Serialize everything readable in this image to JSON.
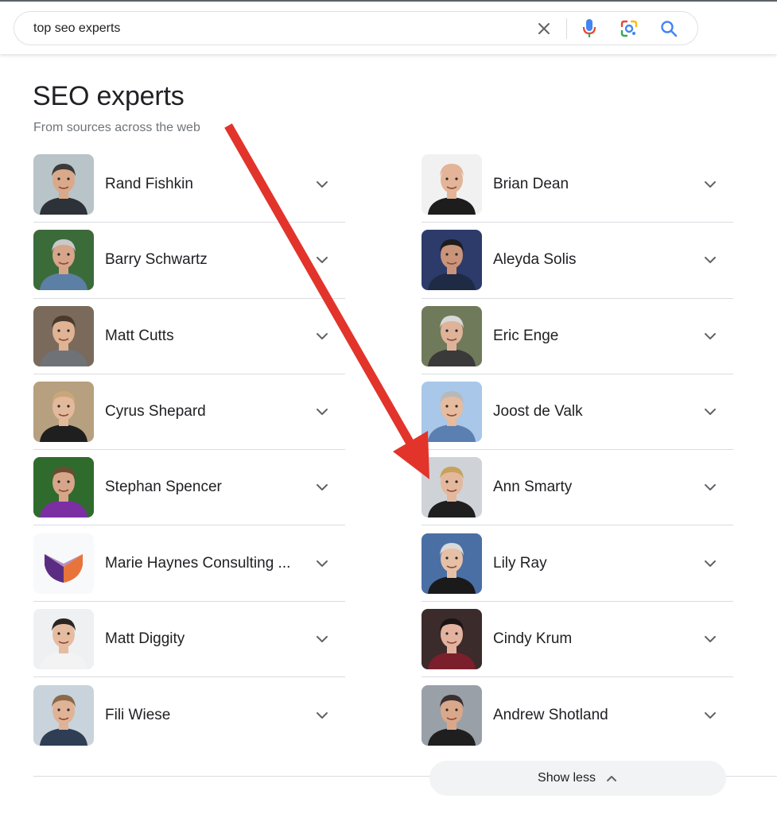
{
  "search": {
    "query": "top seo experts",
    "clear_icon": "close-icon",
    "voice_icon": "mic-icon",
    "lens_icon": "lens-icon",
    "search_icon": "search-icon"
  },
  "section": {
    "title": "SEO experts",
    "subtitle": "From sources across the web"
  },
  "left_column": [
    {
      "name": "Rand Fishkin",
      "bg": "#b9c4c9",
      "skin": "#d9a98a",
      "hair": "#3b3b3b",
      "shirt": "#2d3138"
    },
    {
      "name": "Barry Schwartz",
      "bg": "#3c6b3a",
      "skin": "#d6a58a",
      "hair": "#c9c9c9",
      "shirt": "#5b7fa5"
    },
    {
      "name": "Matt Cutts",
      "bg": "#7a6a5c",
      "skin": "#dfb394",
      "hair": "#4a3a2c",
      "shirt": "#6f7378"
    },
    {
      "name": "Cyrus Shepard",
      "bg": "#b7a07f",
      "skin": "#e3b99c",
      "hair": "#c9a77a",
      "shirt": "#1f1f1f"
    },
    {
      "name": "Stephan Spencer",
      "bg": "#2f6b2c",
      "skin": "#d6a58a",
      "hair": "#6b4c32",
      "shirt": "#7b2fa3"
    },
    {
      "name": "Marie Haynes Consulting ...",
      "bg": "#f8f9fa",
      "logo": true
    },
    {
      "name": "Matt Diggity",
      "bg": "#eef0f2",
      "skin": "#e6bca0",
      "hair": "#2a2522",
      "shirt": "#f3f3f3"
    },
    {
      "name": "Fili Wiese",
      "bg": "#c9d3dc",
      "skin": "#e0b397",
      "hair": "#8a6a4a",
      "shirt": "#2f3d55"
    }
  ],
  "right_column": [
    {
      "name": "Brian Dean",
      "bg": "#f1f1f1",
      "skin": "#e3b497",
      "hair": "#e3b497",
      "shirt": "#1d1d1d"
    },
    {
      "name": "Aleyda Solis",
      "bg": "#2d3b6b",
      "skin": "#c99479",
      "hair": "#1d1d1d",
      "shirt": "#1f2a44"
    },
    {
      "name": "Eric Enge",
      "bg": "#6f7a5a",
      "skin": "#dfb39a",
      "hair": "#d8d8d8",
      "shirt": "#3a3a3a"
    },
    {
      "name": "Joost de Valk",
      "bg": "#a9c7e8",
      "skin": "#e6bb9e",
      "hair": "#b8b8b8",
      "shirt": "#5a7fb0"
    },
    {
      "name": "Ann Smarty",
      "bg": "#cfd3d8",
      "skin": "#e3b89c",
      "hair": "#c7a25c",
      "shirt": "#1f1f1f"
    },
    {
      "name": "Lily Ray",
      "bg": "#4a6fa5",
      "skin": "#e6c0a6",
      "hair": "#d9d9d9",
      "shirt": "#1a1a1a"
    },
    {
      "name": "Cindy Krum",
      "bg": "#3b2b2b",
      "skin": "#e3b3a0",
      "hair": "#1b1414",
      "shirt": "#7a1f2b"
    },
    {
      "name": "Andrew Shotland",
      "bg": "#9aa0a8",
      "skin": "#d9a88b",
      "hair": "#3b3030",
      "shirt": "#1f1f1f"
    }
  ],
  "expand_icon": "chevron-down-icon",
  "show_less": {
    "label": "Show less",
    "icon": "chevron-up-icon"
  },
  "annotation": {
    "arrow_color": "#e2342b"
  },
  "colors": {
    "mic_blue": "#4285f4",
    "mic_red": "#ea4335",
    "search_blue": "#4285f4"
  }
}
